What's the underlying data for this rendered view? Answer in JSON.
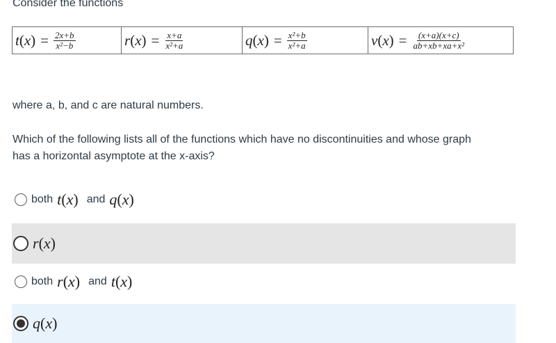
{
  "intro": "Consider the functions",
  "functions": [
    {
      "name": "t",
      "var": "x",
      "num": "2x+b",
      "den": "x²−b"
    },
    {
      "name": "r",
      "var": "x",
      "num": "x+a",
      "den": "x²+a"
    },
    {
      "name": "q",
      "var": "x",
      "num": "x²+b",
      "den": "x²+a"
    },
    {
      "name": "v",
      "var": "x",
      "num": "(x+a)(x+c)",
      "den": "ab+xb+xa+x²"
    }
  ],
  "condition": "where a, b, and c are natural numbers.",
  "question_line1": "Which of the following lists all of the functions which have no discontinuities and whose graph",
  "question_line2": "has a horizontal asymptote at the x-axis?",
  "options": [
    {
      "prefix": "both",
      "f1": "t",
      "joiner": "and",
      "f2": "q",
      "state": "unselected"
    },
    {
      "f1": "r",
      "state": "hover"
    },
    {
      "prefix": "both",
      "f1": "r",
      "joiner": "and",
      "f2": "t",
      "state": "unselected"
    },
    {
      "f1": "q",
      "state": "selected"
    }
  ],
  "colors": {
    "text": "#2d3b45",
    "hover_bg": "#e5e5e5",
    "selected_bg": "#e9f3fb",
    "border": "#6b6b6b"
  }
}
